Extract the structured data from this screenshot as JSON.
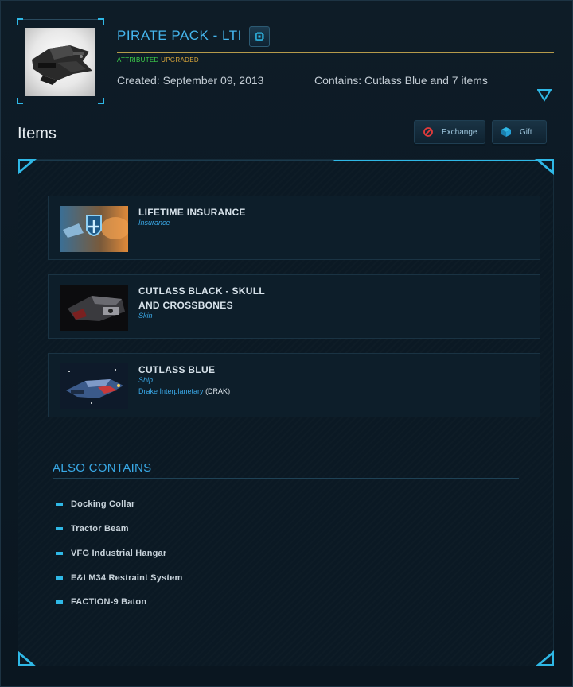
{
  "pack": {
    "title": "PIRATE PACK - LTI",
    "badge_attributed": "ATTRIBUTED",
    "badge_upgraded": "UPGRADED",
    "created": "Created: September 09, 2013",
    "contains": "Contains: Cutlass Blue and 7 items"
  },
  "toolbar": {
    "items_heading": "Items",
    "exchange_label": "Exchange",
    "gift_label": "Gift"
  },
  "items": [
    {
      "name": "LIFETIME INSURANCE",
      "type": "Insurance",
      "manufacturer": "",
      "code": ""
    },
    {
      "name": "CUTLASS BLACK - SKULL AND CROSSBONES",
      "type": "Skin",
      "manufacturer": "",
      "code": ""
    },
    {
      "name": "CUTLASS BLUE",
      "type": "Ship",
      "manufacturer": "Drake Interplanetary",
      "code": "(DRAK)"
    }
  ],
  "also_contains": {
    "heading": "ALSO CONTAINS",
    "items": [
      "Docking Collar",
      "Tractor Beam",
      "VFG Industrial Hangar",
      "E&I M34 Restraint System",
      "FACTION-9 Baton"
    ]
  },
  "icons": {
    "chip": "chip-icon",
    "expand": "expand-triangle-icon",
    "exchange": "no-entry-icon",
    "gift": "gift-box-icon"
  },
  "colors": {
    "accent": "#2fb8e6",
    "title": "#45b6ee",
    "attributed": "#3ed24b",
    "upgraded": "#d9a63a",
    "exchange_icon": "#e23b3b"
  }
}
